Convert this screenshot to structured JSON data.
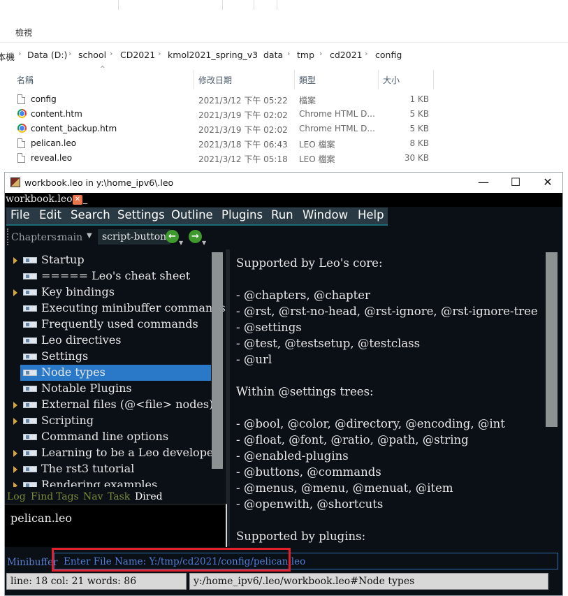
{
  "explorer": {
    "ribbon_tab": "檢視",
    "breadcrumbs": [
      "本機",
      "Data (D:)",
      "school",
      "CD2021",
      "kmol2021_spring_v3",
      "data",
      "tmp",
      "cd2021",
      "config"
    ],
    "columns": {
      "name": "名稱",
      "date": "修改日期",
      "type": "類型",
      "size": "大小"
    },
    "files": [
      {
        "name": "config",
        "date": "2021/3/12 下午 05:22",
        "type": "檔案",
        "size": "1 KB",
        "icon": "file-icon"
      },
      {
        "name": "content.htm",
        "date": "2021/3/19 下午 02:02",
        "type": "Chrome HTML D...",
        "size": "5 KB",
        "icon": "chrome-icon"
      },
      {
        "name": "content_backup.htm",
        "date": "2021/3/19 下午 02:02",
        "type": "Chrome HTML D...",
        "size": "5 KB",
        "icon": "chrome-icon"
      },
      {
        "name": "pelican.leo",
        "date": "2021/3/18 下午 06:43",
        "type": "LEO 檔案",
        "size": "8 KB",
        "icon": "file-icon"
      },
      {
        "name": "reveal.leo",
        "date": "2021/3/12 下午 05:18",
        "type": "LEO 檔案",
        "size": "30 KB",
        "icon": "file-icon"
      }
    ]
  },
  "leo": {
    "window_title": "workbook.leo in y:\\home_ipv6\\.leo",
    "window_controls": {
      "minimize": "—",
      "maximize": "☐",
      "close": "✕"
    },
    "tab_label": "workbook.leo",
    "menu": [
      "File",
      "Edit",
      "Search",
      "Settings",
      "Outline",
      "Plugins",
      "Run",
      "Window",
      "Help"
    ],
    "chapters_label": "Chapters:",
    "chapter_value": "main",
    "script_button": "script-button",
    "outline": [
      {
        "label": "Startup",
        "expandable": true,
        "selected": false
      },
      {
        "label": "===== Leo's cheat sheet",
        "expandable": false,
        "selected": false
      },
      {
        "label": "Key bindings",
        "expandable": true,
        "selected": false
      },
      {
        "label": "Executing minibuffer commands",
        "expandable": false,
        "selected": false
      },
      {
        "label": "Frequently used commands",
        "expandable": false,
        "selected": false
      },
      {
        "label": "Leo directives",
        "expandable": false,
        "selected": false
      },
      {
        "label": "Settings",
        "expandable": false,
        "selected": false
      },
      {
        "label": "Node types",
        "expandable": false,
        "selected": true
      },
      {
        "label": "Notable Plugins",
        "expandable": false,
        "selected": false
      },
      {
        "label": "External files (@<file> nodes)",
        "expandable": true,
        "selected": false
      },
      {
        "label": "Scripting",
        "expandable": true,
        "selected": false
      },
      {
        "label": "Command line options",
        "expandable": false,
        "selected": false
      },
      {
        "label": "Learning to be a Leo developer",
        "expandable": true,
        "selected": false
      },
      {
        "label": "The rst3 tutorial",
        "expandable": true,
        "selected": false
      },
      {
        "label": "Rendering examples",
        "expandable": true,
        "selected": false
      }
    ],
    "body_lines": [
      "Supported by Leo's core:",
      "",
      "- @chapters, @chapter",
      "- @rst, @rst-no-head, @rst-ignore, @rst-ignore-tree",
      "- @settings",
      "- @test, @testsetup, @testclass",
      "- @url",
      "",
      "Within @settings trees:",
      "",
      "- @bool, @color, @directory, @encoding, @int",
      "- @float, @font, @ratio, @path, @string",
      "- @enabled-plugins",
      "- @buttons, @commands",
      "- @menus, @menu, @menuat, @item",
      "- @openwith, @shortcuts",
      "",
      "Supported by plugins:"
    ],
    "log_tabs": [
      "Log",
      "Find",
      "Tags",
      "Nav",
      "Task",
      "Dired"
    ],
    "active_log_tab": "Dired",
    "log_content": "pelican.leo",
    "minibuffer_label": "Minibuffer",
    "minibuffer_text": "Enter File Name: Y:/tmp/cd2021/config/pelican.leo",
    "status_left": "line: 18 col: 21  words: 86",
    "status_right": "y:/home_ipv6/.leo/workbook.leo#Node types"
  },
  "colors": {
    "leo_background": "#0b0f16",
    "selection": "#2a79c8",
    "menubar": "#2a3a44",
    "highlight_box": "#e0202a",
    "minibuffer_text": "#4f7fd8"
  }
}
